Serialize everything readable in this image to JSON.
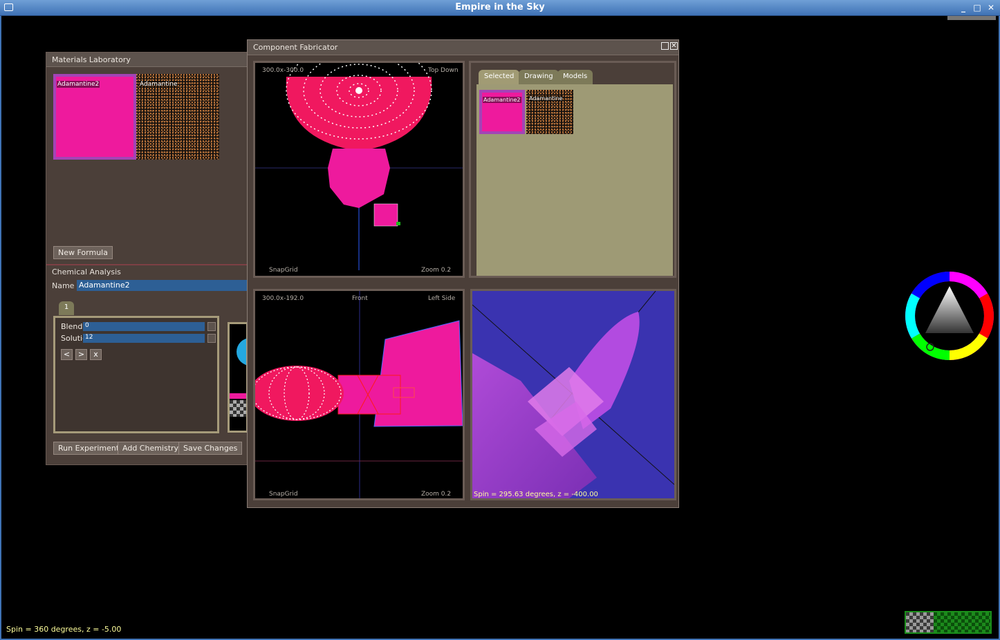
{
  "app": {
    "title": "Empire in the Sky"
  },
  "materials_lab": {
    "title": "Materials Laboratory",
    "swatches": [
      "Adamantine2",
      "Adamantine"
    ],
    "new_formula_label": "New Formula",
    "chem_title": "Chemical Analysis",
    "name_label": "Name",
    "name_value": "Adamantine2",
    "tab_label": "1",
    "sliders": [
      {
        "label": "Blendir",
        "value": "0"
      },
      {
        "label": "Solutic",
        "value": "12"
      }
    ],
    "nav": {
      "prev": "<",
      "next": ">",
      "close": "x"
    },
    "buttons": {
      "run": "Run Experiment",
      "add": "Add Chemistry",
      "save": "Save Changes"
    }
  },
  "fabricator": {
    "title": "Component Fabricator",
    "top_view": {
      "coords": "300.0x-300.0",
      "view": "Top Down",
      "snap": "SnapGrid",
      "zoom": "Zoom 0.2"
    },
    "side_view": {
      "coords": "300.0x-192.0",
      "view": "Front",
      "side": "Left Side",
      "snap": "SnapGrid",
      "zoom": "Zoom 0.2"
    },
    "tabs": [
      "Selected",
      "Drawing",
      "Models"
    ],
    "selected_swatches": [
      "Adamantine2",
      "Adamantine"
    ],
    "render_status": "Spin = 295.63 degrees, z = -400.00"
  },
  "status_bar": "Spin = 360 degrees, z = -5.00",
  "colors": {
    "accent_pink": "#ee1a9d",
    "titlebar": "#3f72b5",
    "panel": "#4b3f39",
    "viewport_bg": "#3a33b0"
  }
}
